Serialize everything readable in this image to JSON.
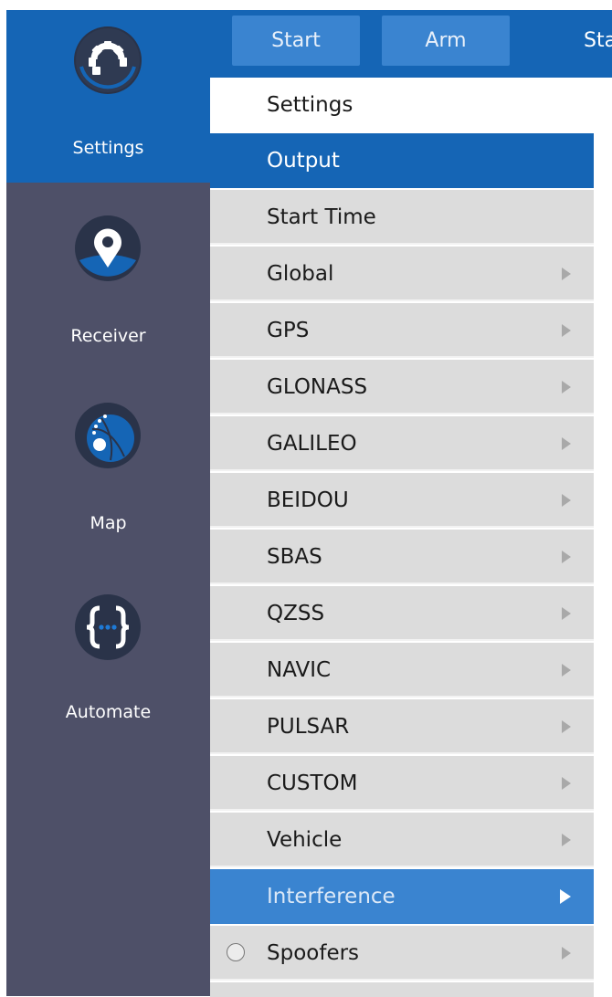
{
  "rail": {
    "items": [
      {
        "label": "Settings",
        "icon": "gear-icon",
        "active": true
      },
      {
        "label": "Receiver",
        "icon": "map-pin-icon",
        "active": false
      },
      {
        "label": "Map",
        "icon": "globe-orbit-icon",
        "active": false
      },
      {
        "label": "Automate",
        "icon": "braces-icon",
        "active": false
      }
    ]
  },
  "header": {
    "start_label": "Start",
    "arm_label": "Arm",
    "cut_label": "Sta"
  },
  "panel": {
    "title": "Settings",
    "items": [
      {
        "label": "Output",
        "state": "selected",
        "submenu": false
      },
      {
        "label": "Start Time",
        "state": "normal",
        "submenu": false
      },
      {
        "label": "Global",
        "state": "normal",
        "submenu": true
      },
      {
        "label": "GPS",
        "state": "normal",
        "submenu": true
      },
      {
        "label": "GLONASS",
        "state": "normal",
        "submenu": true
      },
      {
        "label": "GALILEO",
        "state": "normal",
        "submenu": true
      },
      {
        "label": "BEIDOU",
        "state": "normal",
        "submenu": true
      },
      {
        "label": "SBAS",
        "state": "normal",
        "submenu": true
      },
      {
        "label": "QZSS",
        "state": "normal",
        "submenu": true
      },
      {
        "label": "NAVIC",
        "state": "normal",
        "submenu": true
      },
      {
        "label": "PULSAR",
        "state": "normal",
        "submenu": true
      },
      {
        "label": "CUSTOM",
        "state": "normal",
        "submenu": true
      },
      {
        "label": "Vehicle",
        "state": "normal",
        "submenu": true
      },
      {
        "label": "Interference",
        "state": "highlight",
        "submenu": true
      },
      {
        "label": "Spoofers",
        "state": "normal",
        "submenu": true,
        "radio": true
      }
    ]
  },
  "colors": {
    "accent": "#1565b5",
    "accent_light": "#3a84d0",
    "rail_bg": "#4e5068",
    "menu_bg": "#dcdcdc"
  }
}
